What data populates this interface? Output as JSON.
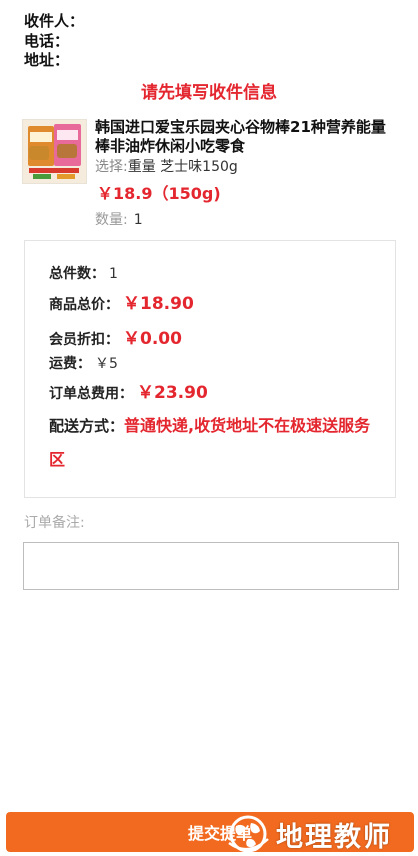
{
  "address": {
    "receiver_label": "收件人：",
    "phone_label": "电话：",
    "address_label": "地址："
  },
  "prompt_text": "请先填写收件信息",
  "product": {
    "title": "韩国进口爱宝乐园夹心谷物棒21种营养能量棒非油炸休闲小吃零食",
    "spec_label": "选择:",
    "spec_value": "重量 芝士味150g",
    "price": "￥18.9（150g)",
    "qty_label": "数量:",
    "qty_value": "1"
  },
  "summary": {
    "count_label": "总件数：",
    "count_value": "1",
    "goods_total_label": "商品总价：",
    "goods_total_value": "￥18.90",
    "member_discount_label": "会员折扣：",
    "member_discount_value": "￥0.00",
    "shipping_fee_label": "运费：",
    "shipping_fee_value": "￥5",
    "order_total_label": "订单总费用：",
    "order_total_value": "￥23.90",
    "delivery_label": "配送方式：",
    "delivery_value": "普通快递,收货地址不在极速送服务区"
  },
  "remark": {
    "label": "订单备注:",
    "value": ""
  },
  "submit_label": "提交提单",
  "watermark_text": "地理教师",
  "colors": {
    "accent_red": "#e4262f",
    "submit_orange": "#f26a1f"
  }
}
